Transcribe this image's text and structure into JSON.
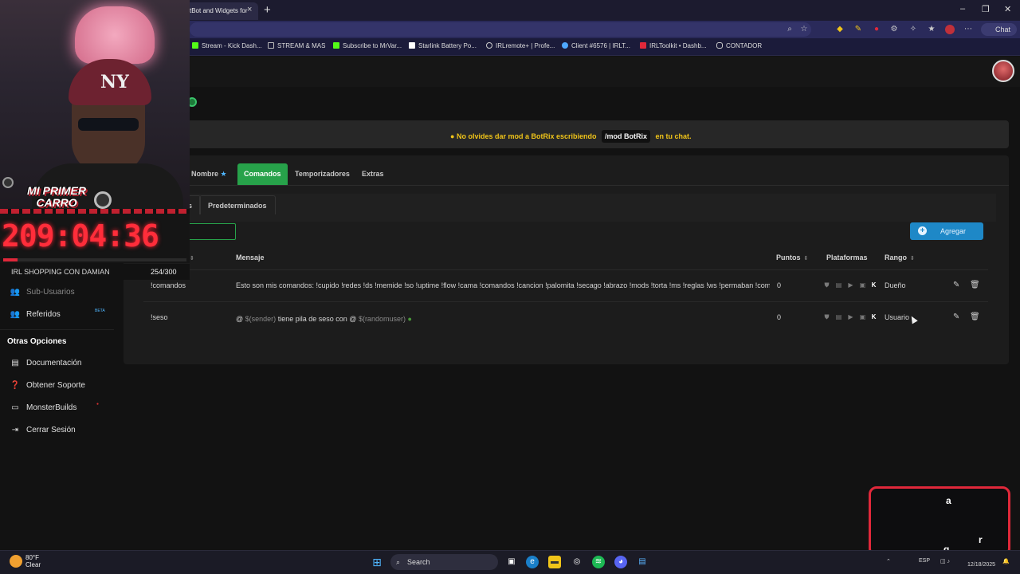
{
  "browser": {
    "tab_title": "tBot and Widgets for",
    "tab_close": "×",
    "new_tab": "+",
    "window_controls": [
      "–",
      "❐",
      "✕"
    ],
    "chat_button": "Chat",
    "bookmarks": [
      {
        "label": "Stream - Kick Dash...",
        "icon": "kick-icon",
        "color": "#53fc18"
      },
      {
        "label": "STREAM & MAS",
        "icon": "folder-icon",
        "color": "#bbbbbb"
      },
      {
        "label": "Subscribe to MrVar...",
        "icon": "kick-icon",
        "color": "#53fc18"
      },
      {
        "label": "Starlink Battery Po...",
        "icon": "starlink-icon",
        "color": "#ffffff"
      },
      {
        "label": "IRLremote+ | Profe...",
        "icon": "globe-icon",
        "color": "#cccccc"
      },
      {
        "label": "Client #6576 | IRLT...",
        "icon": "cloud-icon",
        "color": "#4fa8ff"
      },
      {
        "label": "IRLToolkit • Dashb...",
        "icon": "irltoolkit-icon",
        "color": "#e0283a"
      },
      {
        "label": "CONTADOR",
        "icon": "contador-icon",
        "color": "#cccccc"
      }
    ]
  },
  "notice": {
    "text_before": "No olvides dar mod a BotRix escribiendo",
    "code": "/mod BotRix",
    "text_after": "en tu chat.",
    "icon": "info-circle-icon",
    "color": "#f0c419"
  },
  "main_tabs": [
    {
      "label": "Nombre",
      "active": false
    },
    {
      "label": "Comandos",
      "active": true
    },
    {
      "label": "Temporizadores",
      "active": false
    },
    {
      "label": "Extras",
      "active": false
    }
  ],
  "sub_tabs": [
    {
      "label": "s"
    },
    {
      "label": "Predeterminados"
    }
  ],
  "toolbar": {
    "add_button": "Agregar",
    "accent": "#1e88c7"
  },
  "table": {
    "headers": {
      "message": "Mensaje",
      "points": "Puntos",
      "platforms": "Plataformas",
      "rank": "Rango"
    },
    "rows": [
      {
        "command": "!comandos",
        "message": "Esto son mis comandos: !cupido !redes !ds !memide !so !uptime !flow !cama !comandos !cancion !palomita !secago !abrazo !mods !torta !ms !reglas !ws !permaban !comi",
        "points": "0",
        "rank": "Dueño"
      },
      {
        "command": "!seso",
        "message_parts": [
          "@",
          "$(sender)",
          "tiene pila de seso con",
          "@",
          "$(randomuser)"
        ],
        "points": "0",
        "rank": "Usuario"
      }
    ]
  },
  "sidebar": {
    "items": [
      {
        "label": "Sub-Usuarios",
        "icon": "users-icon"
      },
      {
        "label": "Referidos",
        "icon": "referrals-icon",
        "badge": "BETA"
      }
    ],
    "section_title": "Otras Opciones",
    "options": [
      {
        "label": "Documentación",
        "icon": "book-icon"
      },
      {
        "label": "Obtener Soporte",
        "icon": "help-icon"
      },
      {
        "label": "MonsterBuilds",
        "icon": "monitor-icon"
      },
      {
        "label": "Cerrar Sesión",
        "icon": "logout-icon"
      }
    ]
  },
  "overlay": {
    "cam_title_line1": "MI PRIMER",
    "cam_title_line2": "CARRO",
    "cap_logo": "NY",
    "timer": "209:04:36",
    "goal_label": "IRL SHOPPING CON DAMIAN",
    "goal_count": "254/300",
    "goal_progress": 0.08,
    "corner_letters": [
      "a",
      "r",
      "g"
    ]
  },
  "taskbar": {
    "temperature": "80°F",
    "condition": "Clear",
    "search": "Search",
    "language": "ESP",
    "date": "12/18/2025"
  }
}
